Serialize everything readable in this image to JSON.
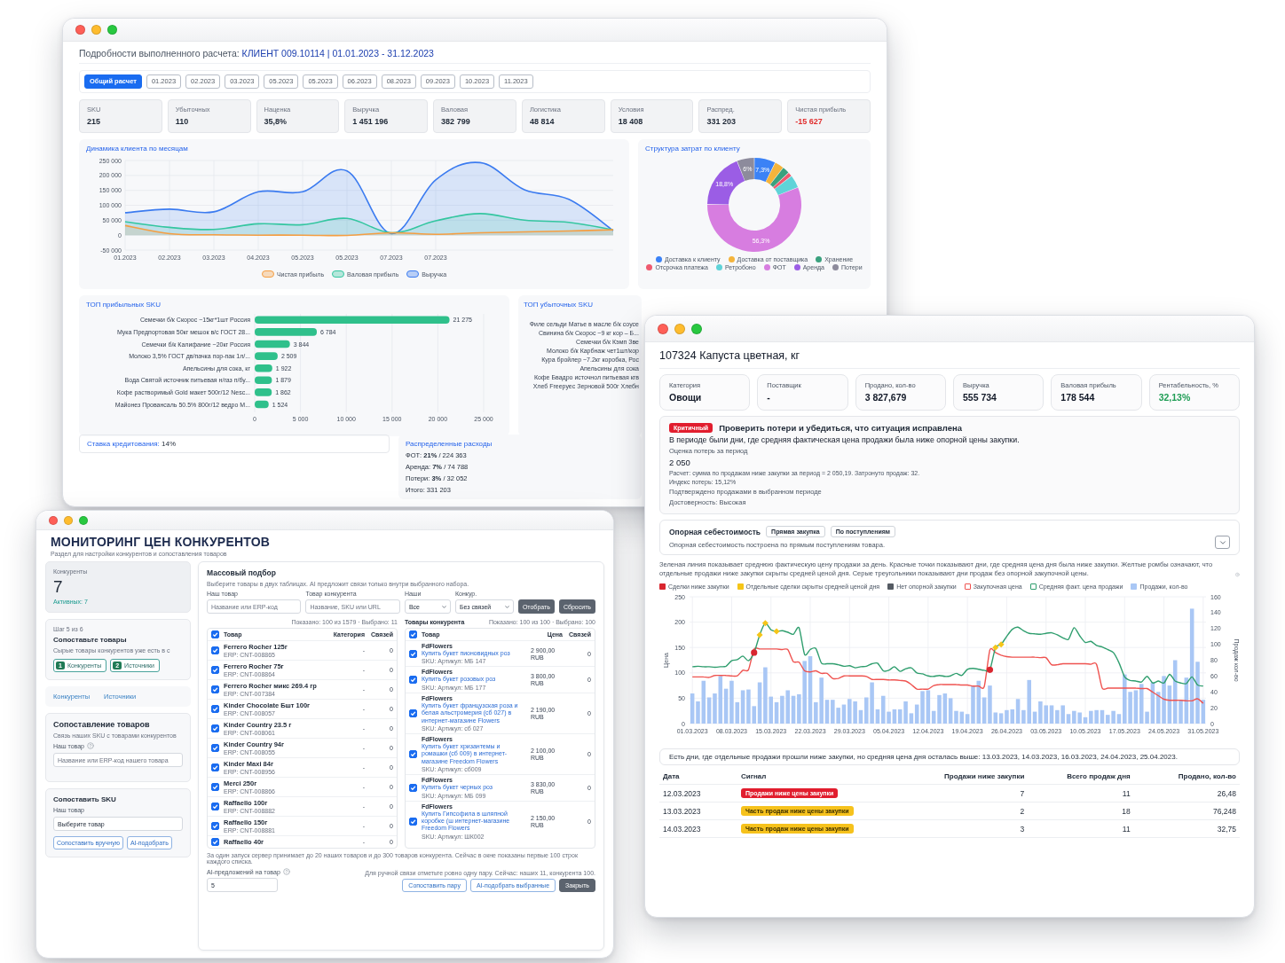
{
  "calculation_window": {
    "heading": {
      "label": "Подробности выполненного расчета:",
      "value": "КЛИЕНТ 009.10114 | 01.01.2023 - 31.12.2023"
    },
    "tabs": [
      {
        "label": "Общий расчет",
        "selected": true
      },
      {
        "label": "01.2023",
        "selected": false
      },
      {
        "label": "02.2023",
        "selected": false
      },
      {
        "label": "03.2023",
        "selected": false
      },
      {
        "label": "05.2023",
        "selected": false
      },
      {
        "label": "05.2023",
        "selected": false
      },
      {
        "label": "06.2023",
        "selected": false
      },
      {
        "label": "08.2023",
        "selected": false
      },
      {
        "label": "09.2023",
        "selected": false
      },
      {
        "label": "10.2023",
        "selected": false
      },
      {
        "label": "11.2023",
        "selected": false
      }
    ],
    "kpis": [
      {
        "label": "SKU",
        "value": "215"
      },
      {
        "label": "Убыточных",
        "value": "110"
      },
      {
        "label": "Наценка",
        "value": "35,8%"
      },
      {
        "label": "Выручка",
        "value": "1 451 196"
      },
      {
        "label": "Валовая",
        "value": "382 799"
      },
      {
        "label": "Логистика",
        "value": "48 814"
      },
      {
        "label": "Условия",
        "value": "18 408"
      },
      {
        "label": "Распред.",
        "value": "331 203"
      },
      {
        "label": "Чистая прибыль",
        "value": "-15 627",
        "color": "#e02d2d"
      }
    ],
    "monthly_dynamics": {
      "title": "Динамика клиента по месяцам",
      "chart_data": {
        "type": "area",
        "categories": [
          "01.2023",
          "02.2023",
          "03.2023",
          "04.2023",
          "05.2023",
          "05.2023",
          "07.2023",
          "07.2023",
          null,
          null,
          null,
          null
        ],
        "ylim": [
          -50000,
          250000
        ],
        "yticks": [
          {
            "value": -50000,
            "label": "-50 000"
          },
          {
            "value": 0,
            "label": "0"
          },
          {
            "value": 50000,
            "label": "50 000"
          },
          {
            "value": 100000,
            "label": "100 000"
          },
          {
            "value": 150000,
            "label": "150 000"
          },
          {
            "value": 200000,
            "label": "200 000"
          },
          {
            "value": 250000,
            "label": "250 000"
          }
        ],
        "grid": true,
        "legend": "bottom",
        "series": [
          {
            "name": "Чистая прибыль",
            "color": "#f59e42",
            "values": [
              32000,
              5000,
              1000,
              0,
              0,
              -1000,
              8000,
              3000,
              8000,
              11000,
              14000,
              18000
            ]
          },
          {
            "name": "Валовая прибыль",
            "color": "#34c6a0",
            "values": [
              45000,
              26000,
              19000,
              38000,
              35000,
              56000,
              8000,
              48000,
              72000,
              50000,
              43000,
              18000
            ]
          },
          {
            "name": "Выручка",
            "color": "#3b7bf0",
            "values": [
              75000,
              87000,
              78000,
              145000,
              145000,
              215000,
              5000,
              185000,
              243000,
              152000,
              120000,
              15000
            ]
          }
        ]
      }
    },
    "cost_structure": {
      "title": "Структура затрат по клиенту",
      "chart_data": {
        "type": "donut",
        "categories": [
          "Доставка к клиенту",
          "Доставка от поставщика",
          "Хранение",
          "Отсрочка платежа",
          "Ретробоно",
          "ФОТ",
          "Аренда",
          "Потери"
        ],
        "values": [
          7.3,
          3.2,
          2.5,
          1.5,
          4.4,
          56.3,
          18.8,
          6.0
        ],
        "colors": [
          "#3b82f6",
          "#f4b43c",
          "#3aa17e",
          "#ef5a6f",
          "#5fd3d8",
          "#d77de0",
          "#9b5de5",
          "#8d8b9c"
        ],
        "value_labels": [
          "7,3%",
          null,
          null,
          null,
          null,
          "56,3%",
          "18,8%",
          "6%"
        ],
        "legend": "bottom"
      }
    },
    "top_profit": {
      "title": "ТОП прибыльных SKU",
      "chart_data": {
        "type": "bar",
        "orientation": "horizontal",
        "categories": [
          "Семечки б/к Скорос ~15кг*1шт Россия",
          "Мука Предпортовая 50кг мешок в/с ГОСТ 28...",
          "Семечки б/к Калифание ~20кг Россия",
          "Молоко 3,5% ГОСТ дв/пачка пор-пак 1л/...",
          "Апельсины для сока, кг",
          "Вода Святой источник питьевая н/газ п/бу...",
          "Кофе растворимый Gold макет 500г/12 Nesc...",
          "Майонез Провансаль 50.5% 800г/12 ведро М..."
        ],
        "values": [
          21275,
          6784,
          3844,
          2509,
          1922,
          1879,
          1862,
          1524
        ],
        "value_labels": [
          "21 275",
          "6 784",
          "3 844",
          "2 509",
          "1 922",
          "1 879",
          "1 862",
          "1 524"
        ],
        "xlim": [
          0,
          25000
        ],
        "xticks": [
          0,
          {
            "value": 5000,
            "label": "5 000"
          },
          {
            "value": 10000,
            "label": "10 000"
          },
          {
            "value": 15000,
            "label": "15 000"
          },
          {
            "value": 20000,
            "label": "20 000"
          },
          {
            "value": 25000,
            "label": "25 000"
          }
        ],
        "grid": true
      }
    },
    "top_loss": {
      "title": "ТОП убыточных SKU",
      "items": [
        "Филе сельди Матье в масле б/к соусе",
        "Свинина б/к Скорос ~9 кг кор – Б...",
        "Семечки б/к Кэмп Зве",
        "Молоко б/к Карбнаж чет1шт/кор",
        "Кура бройлер ~7.2кг коробка, Рос",
        "Апельсины для сока",
        "Кофе Бвадро источнол питьевая кгв",
        "Хлеб Freepуес Зерновой 500г Хлебн"
      ]
    },
    "credit_rate": {
      "label": "Ставка кредитования:",
      "value": "14%"
    },
    "distributed_costs": {
      "title": "Распределенные расходы",
      "lines": [
        "ФОТ: **21%** / 224 363",
        "Аренда: **7%** / 74 788",
        "Потери: **3%** / 32 052",
        "Итого: 331 203"
      ]
    }
  },
  "competitor_window": {
    "title": "МОНИТОРИНГ ЦЕН КОНКУРЕНТОВ",
    "subtitle": "Раздел для настройки конкурентов и сопоставления товаров",
    "competitors_card": {
      "label": "Конкуренты",
      "count": "7",
      "active": "Активных: 7"
    },
    "step_card": {
      "step": "Шаг 5 из 6",
      "title": "Сопоставьте товары",
      "text": "Сырые товары конкурентов уже есть в с",
      "buttons": [
        {
          "number": "1",
          "label": "Конкуренты"
        },
        {
          "number": "2",
          "label": "Источники"
        }
      ]
    },
    "links": [
      "Конкуренты",
      "Источники"
    ],
    "matching_card": {
      "title": "Сопоставление товаров",
      "subtitle": "Связь наших SKU с товарами конкурентов",
      "field_label": "Наш товар",
      "placeholder": "Название или ERP-код нашего товара"
    },
    "sku_card": {
      "title": "Сопоставить SKU",
      "field_label": "Наш товар",
      "select_value": "Выберите товар",
      "buttons": [
        "Сопоставить вручную",
        "AI-подобрать"
      ]
    },
    "bulk": {
      "title": "Массовый подбор",
      "subtitle": "Выберите товары в двух таблицах. AI предложит связи только внутри выбранного набора.",
      "filters": [
        {
          "kind": "input",
          "label": "Наш товар",
          "placeholder": "Название или ERP-код"
        },
        {
          "kind": "input",
          "label": "Товар конкурента",
          "placeholder": "Название, SKU или URL"
        },
        {
          "kind": "select",
          "label": "Наши",
          "value": "Все"
        },
        {
          "kind": "select",
          "label": "Конкур.",
          "value": "Без связей"
        }
      ],
      "filter_buttons": [
        "Отобрать",
        "Сбросить"
      ],
      "our_table": {
        "caption": "Показано: 100 из 1579 · Выбрано: 11",
        "all_checked": true,
        "columns": [
          "Товар",
          "Категория",
          "Связей"
        ],
        "rows": [
          {
            "name": "Ferrero Rocher 125г",
            "erp": "ERP: CNT-008865",
            "category": "-",
            "links": "0",
            "checked": true
          },
          {
            "name": "Ferrero Rocher 75г",
            "erp": "ERP: CNT-008864",
            "category": "-",
            "links": "0",
            "checked": true
          },
          {
            "name": "Ferrero Rocher микс 269.4 гр",
            "erp": "ERP: CNT-007384",
            "category": "-",
            "links": "0",
            "checked": true
          },
          {
            "name": "Kinder Chocolate Бшт 100г",
            "erp": "ERP: CNT-008057",
            "category": "-",
            "links": "0",
            "checked": true
          },
          {
            "name": "Kinder Country 23.5 г",
            "erp": "ERP: CNT-008061",
            "category": "-",
            "links": "0",
            "checked": true
          },
          {
            "name": "Kinder Country 94г",
            "erp": "ERP: CNT-008055",
            "category": "-",
            "links": "0",
            "checked": true
          },
          {
            "name": "Kinder Maxi 84г",
            "erp": "ERP: CNT-008956",
            "category": "-",
            "links": "0",
            "checked": true
          },
          {
            "name": "Merci 250г",
            "erp": "ERP: CNT-008866",
            "category": "-",
            "links": "0",
            "checked": true
          },
          {
            "name": "Raffaello 100г",
            "erp": "ERP: CNT-008882",
            "category": "-",
            "links": "0",
            "checked": true
          },
          {
            "name": "Raffaello 150г",
            "erp": "ERP: CNT-008881",
            "category": "-",
            "links": "0",
            "checked": true
          },
          {
            "name": "Raffaello 40г",
            "category": "-",
            "links": "0",
            "checked": true
          }
        ]
      },
      "competitor_table": {
        "title": "Товары конкурента",
        "caption": "Показано: 100 из 100 · Выбрано: 100",
        "all_checked": true,
        "columns": [
          "Товар",
          "Цена",
          "Связей"
        ],
        "rows": [
          {
            "shop": "FdFlowers",
            "name": "Купить букет пионовидных роз",
            "sku": "SKU: Артикул: МБ 147",
            "price": "2 900,00",
            "currency": "RUB",
            "links": "0",
            "checked": true
          },
          {
            "shop": "FdFlowers",
            "name": "Купить букет розовых роз",
            "sku": "SKU: Артикул: МБ 177",
            "price": "3 800,00",
            "currency": "RUB",
            "links": "0",
            "checked": true
          },
          {
            "shop": "FdFlowers",
            "name": "Купить букет французская роза и белая альстромерия (сб 027) в интернет-магазине Flowers",
            "sku": "SKU: Артикул: сб 027",
            "price": "2 190,00",
            "currency": "RUB",
            "links": "0",
            "checked": true
          },
          {
            "shop": "FdFlowers",
            "name": "Купить букет хризантемы и ромашки (сб 009) в интернет-магазине Freedom Flowers",
            "sku": "SKU: Артикул: сб009",
            "price": "2 100,00",
            "currency": "RUB",
            "links": "0",
            "checked": true
          },
          {
            "shop": "FdFlowers",
            "name": "Купить букет черных роз",
            "sku": "SKU: Артикул: МБ 099",
            "price": "3 830,00",
            "currency": "RUB",
            "links": "0",
            "checked": true
          },
          {
            "shop": "FdFlowers",
            "name": "Купить Гипсофила в шляпной коробке (ш интернет-магазине Freedom Flowers",
            "sku": "SKU: Артикул: ШК002",
            "price": "2 150,00",
            "currency": "RUB",
            "links": "0",
            "checked": true
          }
        ]
      },
      "note": "За один запуск сервер принимает до 20 наших товаров и до 300 товаров конкурента. Сейчас в окне показаны первые 100 строк каждого списка.",
      "suggestions_label": "AI-предложений на товар",
      "suggestions_value": "5",
      "hint": "Для ручной связи отметьте ровно одну пару. Сейчас: наших 11, конкурента 100.",
      "actions": [
        {
          "label": "Сопоставить пару",
          "kind": "outline"
        },
        {
          "label": "AI-подобрать выбранные",
          "kind": "outline"
        },
        {
          "label": "Закрыть",
          "kind": "dark"
        }
      ]
    }
  },
  "product_window": {
    "title": "107324 Капуста цветная, кг",
    "kpis": [
      {
        "label": "Категория",
        "value": "Овощи"
      },
      {
        "label": "Поставщик",
        "value": "-"
      },
      {
        "label": "Продано, кол-во",
        "value": "3 827,679"
      },
      {
        "label": "Выручка",
        "value": "555 734"
      },
      {
        "label": "Валовая прибыль",
        "value": "178 544"
      },
      {
        "label": "Рентабельность, %",
        "value": "32,13%",
        "color": "#1f9d55"
      }
    ],
    "alert": {
      "badge": {
        "label": "Критичный",
        "kind": "critical"
      },
      "title": "Проверить потери и убедиться, что ситуация исправлена",
      "text": "В периоде были дни, где средняя фактическая цена продажи была ниже опорной цены закупки.",
      "loss_label": "Оценка потерь за период",
      "loss_value": "2 050",
      "calculation": "Расчет: сумма по продажам ниже закупки за период = 2 050,19. Затронуто продаж: 32.",
      "loss_index": "Индекс потерь: 15,12%",
      "confirmation": "Подтверждено продажами в выбранном периоде",
      "reliability": "Достоверность: Высокая"
    },
    "cost_basis": {
      "title": "Опорная себестоимость",
      "options": [
        "Прямая закупка",
        "По поступлениям"
      ],
      "text": "Опорная себестоимость построена по прямым поступлениям товара.",
      "expanded": false
    },
    "chart_description": "Зеленая линия показывает среднюю фактическую цену продажи за день. Красные точки показывают дни, где средняя цена дня была ниже закупки. Желтые ромбы означают, что отдельные продажи ниже закупки скрыты средней ценой дня. Серые треугольники показывают дни продаж без опорной закупочной цены.",
    "price_chart": {
      "chart_data": {
        "type": "line",
        "ylabel": "Цена",
        "y2label": "Продаж кол-во",
        "categories": [
          "01.03.2023",
          null,
          null,
          null,
          null,
          null,
          null,
          "08.03.2023",
          null,
          null,
          null,
          null,
          null,
          null,
          "15.03.2023",
          null,
          null,
          null,
          null,
          null,
          null,
          "22.03.2023",
          null,
          null,
          null,
          null,
          null,
          null,
          "29.03.2023",
          null,
          null,
          null,
          null,
          null,
          null,
          "05.04.2023",
          null,
          null,
          null,
          null,
          null,
          null,
          "12.04.2023",
          null,
          null,
          null,
          null,
          null,
          null,
          "19.04.2023",
          null,
          null,
          null,
          null,
          null,
          null,
          "26.04.2023",
          null,
          null,
          null,
          null,
          null,
          null,
          "03.05.2023",
          null,
          null,
          null,
          null,
          null,
          null,
          "10.05.2023",
          null,
          null,
          null,
          null,
          null,
          null,
          "17.05.2023",
          null,
          null,
          null,
          null,
          null,
          null,
          "24.05.2023",
          null,
          null,
          null,
          null,
          null,
          null,
          "31.05.2023"
        ],
        "ylim": [
          0,
          250
        ],
        "yticks": [
          0,
          50,
          100,
          150,
          200,
          250
        ],
        "y2lim": [
          0,
          160
        ],
        "y2ticks": [
          0,
          20,
          40,
          60,
          80,
          100,
          120,
          140,
          160
        ],
        "grid": true,
        "legend": "top",
        "series": [
          {
            "name": "Сделки ниже закупки",
            "color": "#d9262f",
            "type": "scatter",
            "marker": "circle",
            "values": [
              null,
              null,
              null,
              null,
              null,
              null,
              null,
              null,
              null,
              null,
              null,
              140,
              null,
              null,
              null,
              null,
              null,
              null,
              null,
              null,
              null,
              null,
              null,
              null,
              null,
              null,
              null,
              null,
              null,
              null,
              null,
              null,
              null,
              null,
              null,
              null,
              null,
              null,
              null,
              null,
              null,
              null,
              null,
              null,
              null,
              null,
              null,
              null,
              null,
              null,
              null,
              null,
              null,
              106,
              null,
              null,
              null,
              null,
              null,
              null,
              null,
              null,
              null,
              null,
              null,
              null,
              null,
              null,
              null,
              null,
              null,
              null,
              null,
              null,
              null,
              null,
              null,
              null,
              null,
              null,
              null,
              null,
              null,
              null,
              null,
              null,
              null,
              null,
              null,
              null,
              null,
              null
            ]
          },
          {
            "name": "Отдельные сделки скрыты средней ценой дня",
            "color": "#f5c518",
            "type": "scatter",
            "marker": "diamond",
            "values": [
              null,
              null,
              null,
              null,
              null,
              null,
              null,
              null,
              null,
              null,
              null,
              null,
              175,
              198,
              null,
              182,
              null,
              null,
              null,
              null,
              null,
              null,
              null,
              null,
              null,
              null,
              null,
              null,
              null,
              null,
              null,
              null,
              null,
              null,
              null,
              null,
              null,
              null,
              null,
              null,
              null,
              null,
              null,
              null,
              null,
              null,
              null,
              null,
              null,
              null,
              null,
              null,
              null,
              null,
              150,
              156,
              null,
              null,
              null,
              null,
              null,
              null,
              null,
              null,
              null,
              null,
              null,
              null,
              null,
              null,
              null,
              null,
              null,
              null,
              null,
              null,
              null,
              null,
              null,
              null,
              null,
              null,
              null,
              null,
              null,
              null,
              null,
              null,
              null,
              null,
              null,
              null
            ]
          },
          {
            "name": "Нет опорной закупки",
            "color": "#555b63",
            "type": "scatter",
            "values": [
              null,
              null,
              null,
              null,
              null,
              null,
              null,
              null,
              null,
              null,
              null,
              null,
              null,
              null,
              null,
              null,
              null,
              null,
              null,
              null,
              null,
              null,
              null,
              null,
              null,
              null,
              null,
              null,
              null,
              null,
              null,
              null,
              null,
              null,
              null,
              null,
              null,
              null,
              null,
              null,
              null,
              null,
              null,
              null,
              null,
              null,
              null,
              null,
              null,
              null,
              null,
              null,
              null,
              null,
              null,
              null,
              null,
              null,
              null,
              null,
              null,
              null,
              null,
              null,
              null,
              null,
              null,
              null,
              null,
              null,
              null,
              null,
              null,
              null,
              null,
              null,
              null,
              null,
              null,
              null,
              null,
              null,
              null,
              null,
              null,
              null,
              null,
              null,
              null,
              null,
              null,
              null
            ]
          },
          {
            "name": "Закупочная цена",
            "color": "#ef5350",
            "type": "line",
            "values": [
              92,
              92,
              92,
              91,
              95,
              95,
              95,
              94,
              94,
              105,
              106,
              147,
              147,
              147,
              147,
              147,
              146,
              146,
              122,
              121,
              104,
              102,
              104,
              99,
              99,
              89,
              89,
              94,
              94,
              94,
              94,
              93,
              87,
              87,
              87,
              86,
              86,
              85,
              84,
              77,
              68,
              68,
              68,
              75,
              77,
              77,
              77,
              77,
              76,
              76,
              74,
              74,
              73,
              145,
              140,
              135,
              132,
              131,
              131,
              131,
              131,
              131,
              130,
              130,
              116,
              116,
              118,
              118,
              118,
              118,
              118,
              117,
              117,
              70,
              70,
              70,
              70,
              70,
              70,
              70,
              69,
              69,
              62,
              55,
              48,
              46,
              46,
              46,
              45,
              45,
              49,
              40
            ]
          },
          {
            "name": "Средняя факт. цена продажи",
            "color": "#2f9e6e",
            "type": "line",
            "values": [
              112,
              113,
              112,
              112,
              111,
              112,
              113,
              124,
              126,
              133,
              124,
              140,
              175,
              198,
              185,
              182,
              183,
              180,
              176,
              189,
              136,
              146,
              148,
              119,
              118,
              118,
              116,
              113,
              114,
              110,
              112,
              113,
              118,
              119,
              104,
              105,
              112,
              103,
              108,
              110,
              100,
              98,
              94,
              93,
              95,
              93,
              94,
              99,
              95,
              107,
              109,
              107,
              105,
              106,
              150,
              156,
              172,
              186,
              190,
              183,
              178,
              177,
              176,
              178,
              179,
              175,
              169,
              166,
              189,
              173,
              160,
              162,
              154,
              151,
              146,
              140,
              120,
              92,
              85,
              84,
              82,
              93,
              80,
              84,
              80,
              97,
              84,
              80,
              79,
              92,
              76,
              74
            ]
          },
          {
            "name": "Продажи, кол-во",
            "color": "#a9c7f5",
            "type": "bar",
            "axis": "y2",
            "values": [
              38,
              28,
              54,
              33,
              38,
              60,
              44,
              54,
              27,
              42,
              43,
              22,
              52,
              71,
              34,
              27,
              35,
              42,
              35,
              37,
              79,
              85,
              27,
              58,
              30,
              30,
              20,
              24,
              31,
              28,
              17,
              33,
              52,
              18,
              35,
              15,
              18,
              18,
              28,
              13,
              24,
              41,
              42,
              16,
              36,
              38,
              32,
              16,
              15,
              12,
              48,
              54,
              33,
              48,
              14,
              13,
              17,
              18,
              31,
              17,
              55,
              15,
              28,
              23,
              23,
              17,
              23,
              12,
              16,
              14,
              8,
              16,
              17,
              17,
              11,
              16,
              12,
              62,
              40,
              42,
              50,
              15,
              52,
              40,
              60,
              48,
              80,
              30,
              58,
              145,
              78,
              30
            ]
          }
        ]
      }
    },
    "note": "Есть дни, где отдельные продажи прошли ниже закупки, но средняя цена дня осталась выше: 13.03.2023, 14.03.2023, 16.03.2023, 24.04.2023, 25.04.2023.",
    "table": {
      "columns": [
        "Дата",
        "Сигнал",
        "Продажи ниже закупки",
        "Всего продаж дня",
        "Продано, кол-во"
      ],
      "rows": [
        {
          "date": "12.03.2023",
          "signal": {
            "kind": "critical",
            "label": "Продажи ниже цены закупки"
          },
          "below": "7",
          "total": "11",
          "sold": "26,48"
        },
        {
          "date": "13.03.2023",
          "signal": {
            "kind": "partial",
            "label": "Часть продаж ниже цены закупки"
          },
          "below": "2",
          "total": "18",
          "sold": "76,248"
        },
        {
          "date": "14.03.2023",
          "signal": {
            "kind": "partial",
            "label": "Часть продаж ниже цены закупки"
          },
          "below": "3",
          "total": "11",
          "sold": "32,75"
        }
      ]
    }
  }
}
